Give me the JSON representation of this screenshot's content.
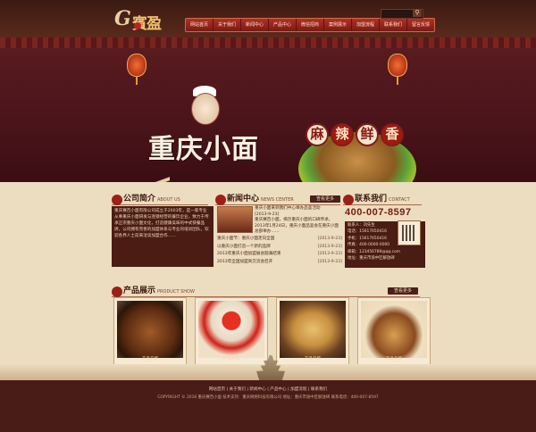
{
  "brand": {
    "logo_text": "G",
    "logo_cn": "賓盈"
  },
  "nav": [
    "网站首页",
    "关于我们",
    "新闻中心",
    "产品中心",
    "微信招商",
    "案例展示",
    "加盟流程",
    "联系我们",
    "留言反馈"
  ],
  "banner": {
    "title": "重庆小面",
    "badges": [
      "麻",
      "辣",
      "鲜",
      "香"
    ]
  },
  "about": {
    "title_cn": "公司简介",
    "title_en": "ABOUT US",
    "text": "重庆赛百小面有限公司成立于2003年，是一家专业从事重庆小面研发与连锁经营的餐饮企业，致力于传承正宗重庆小面文化，打造健康美味的中式快餐品牌，公司拥有完善的加盟体系与专业的培训团队，欢迎各界人士前来洽谈加盟合作……"
  },
  "news": {
    "title_cn": "新闻中心",
    "title_en": "NEWS CENTER",
    "more": "查看更多",
    "featured": {
      "title": "重庆小面来到我们中心举办品鉴活动",
      "date": "[2013-9-23]",
      "summary": "重庆赛百小面，揭示重庆小面的口碑传承，2013年1月24日，重庆小面品鉴会在重庆小面总部举办……"
    },
    "items": [
      {
        "title": "重庆小面节：重庆小面走向全国",
        "date": "[2013-9-23]"
      },
      {
        "title": "以重庆小面打造一个新的品牌",
        "date": "[2013-9-23]"
      },
      {
        "title": "2013年重庆小面加盟展会圆满结束",
        "date": "[2013-9-23]"
      },
      {
        "title": "2013年全国加盟商交流会召开",
        "date": "[2013-9-23]"
      }
    ]
  },
  "contact": {
    "title_cn": "联系我们",
    "title_en": "CONTACT",
    "phone": "400-007-8597",
    "lines": [
      "联系人：刘先生",
      "电话：15617650416",
      "手机：15617650416",
      "传真：400-0000-0000",
      "邮箱：123456789@qq.com",
      "地址：重庆市渝中区解放碑"
    ]
  },
  "products": {
    "title_cn": "产品展示",
    "title_en": "PRODUCT SHOW",
    "more": "查看更多",
    "items": [
      {
        "label": "产品名称"
      },
      {
        "label": "产品名称"
      },
      {
        "label": "产品名称"
      },
      {
        "label": "产品名称"
      }
    ]
  },
  "footer": {
    "links": "网站首页 | 关于我们 | 新闻中心 | 产品中心 | 加盟流程 | 联系我们",
    "copyright": "COPYRIGHT © 2016 重庆赛百小面 技术支持：重庆网络科技有限公司 地址：重庆市渝中区解放碑 联系电话：400-007-8597"
  }
}
